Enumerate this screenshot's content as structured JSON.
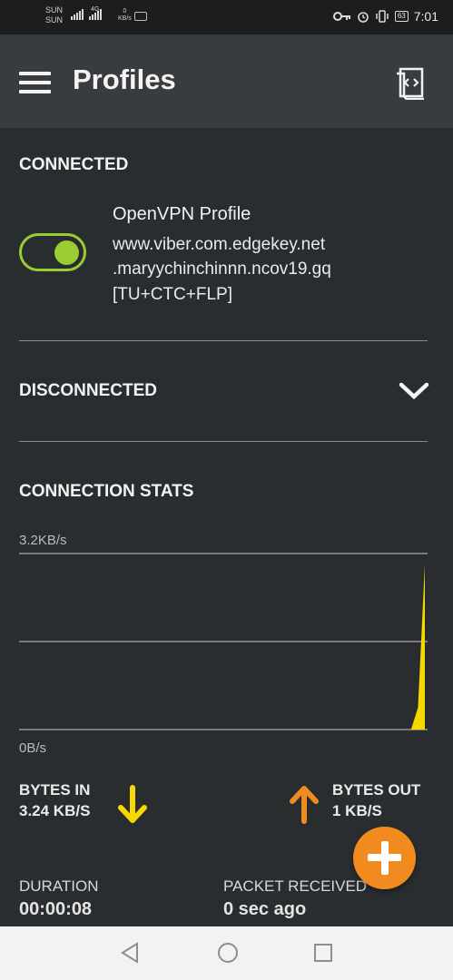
{
  "status_bar": {
    "carrier1": "SUN",
    "carrier2": "SUN",
    "network": "4G",
    "speed_value": "0",
    "speed_unit": "KB/s",
    "battery": "63",
    "time": "7:01"
  },
  "app_bar": {
    "title": "Profiles",
    "menu_icon": "hamburger-menu-icon",
    "import_icon": "import-profile-icon"
  },
  "connected": {
    "header": "CONNECTED",
    "profile": {
      "name": "OpenVPN Profile",
      "lines": [
        "www.viber.com.edgekey.net",
        ".maryychinchinnn.ncov19.gq",
        "[TU+CTC+FLP]"
      ],
      "enabled": true
    }
  },
  "disconnected": {
    "header": "DISCONNECTED",
    "icon": "chevron-down-icon"
  },
  "stats": {
    "header": "CONNECTION STATS",
    "chart_data": {
      "type": "area",
      "title": "",
      "xlabel": "",
      "ylabel": "",
      "y_tick_top": "3.2KB/s",
      "y_tick_bottom": "0B/s",
      "ylim": [
        0,
        3.2
      ],
      "y_unit": "KB/s",
      "gridlines": 3,
      "color": "#f5d800",
      "series": [
        {
          "values": [
            0,
            0,
            0,
            0,
            0,
            0,
            0,
            0,
            0,
            0,
            0,
            0,
            0,
            0,
            0,
            0,
            0,
            0,
            0,
            0,
            0,
            0,
            0,
            0,
            0,
            0,
            0,
            0,
            0,
            0,
            0,
            0,
            0,
            0,
            0,
            0,
            0,
            0,
            0,
            0,
            0,
            0,
            0,
            0,
            0,
            0,
            0,
            0,
            0,
            0,
            0,
            0,
            0,
            0,
            0,
            0,
            0,
            0,
            0.4,
            3.0
          ]
        }
      ]
    },
    "bytes_in_label": "BYTES IN",
    "bytes_in_value": "3.24 KB/S",
    "bytes_out_label": "BYTES OUT",
    "bytes_out_value": "1 KB/S",
    "in_color": "#f5d800",
    "out_color": "#f28b1f",
    "duration_label": "DURATION",
    "duration_value": "00:00:08",
    "packet_label": "PACKET RECEIVED",
    "packet_value": "0 sec ago"
  },
  "fab": {
    "icon": "plus-icon",
    "color": "#f28b1f"
  },
  "nav": {
    "back": "back-icon",
    "home": "home-icon",
    "recents": "recents-icon"
  }
}
